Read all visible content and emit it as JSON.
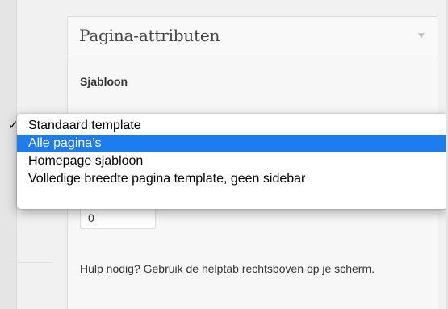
{
  "metabox": {
    "title": "Pagina-attributen",
    "template_label": "Sjabloon",
    "selected_template": "Standaard template",
    "order_value": "0",
    "help_text": "Hulp nodig? Gebruik de helptab rechtsboven op je scherm."
  },
  "dropdown": {
    "options": [
      {
        "label": "Standaard template",
        "checked": true
      },
      {
        "label": "Alle pagina’s",
        "highlighted": true
      },
      {
        "label": "Homepage sjabloon"
      },
      {
        "label": "Volledige breedte pagina template, geen sidebar"
      }
    ],
    "checkmark": "✓"
  },
  "colors": {
    "highlight": "#1c7cf0",
    "background": "#f1f1f1"
  }
}
